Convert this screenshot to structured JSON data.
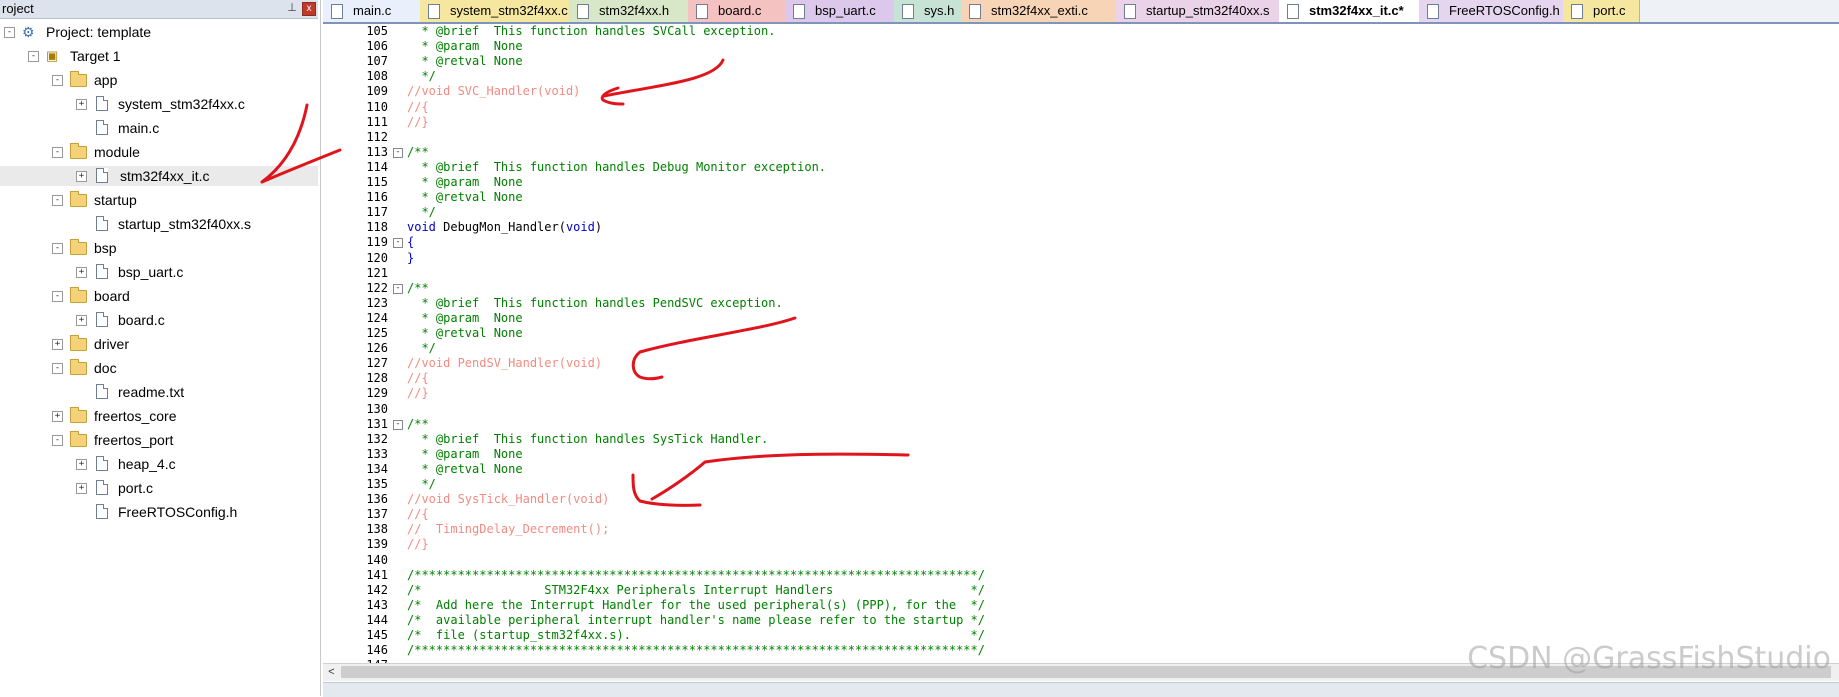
{
  "project_panel": {
    "header_title": "roject",
    "pin_glyph": "⊥",
    "close_glyph": "x",
    "tree": [
      {
        "label": "Project: template",
        "type": "project",
        "level": 0,
        "expander": "-"
      },
      {
        "label": "Target 1",
        "type": "target",
        "level": 1,
        "expander": "-"
      },
      {
        "label": "app",
        "type": "folder",
        "level": 2,
        "expander": "-"
      },
      {
        "label": "system_stm32f4xx.c",
        "type": "file",
        "level": 3,
        "expander": "+"
      },
      {
        "label": "main.c",
        "type": "file",
        "level": 3,
        "expander": ""
      },
      {
        "label": "module",
        "type": "folder",
        "level": 2,
        "expander": "-"
      },
      {
        "label": "stm32f4xx_it.c",
        "type": "file",
        "level": 3,
        "expander": "+",
        "selected": true
      },
      {
        "label": "startup",
        "type": "folder",
        "level": 2,
        "expander": "-"
      },
      {
        "label": "startup_stm32f40xx.s",
        "type": "file",
        "level": 3,
        "expander": ""
      },
      {
        "label": "bsp",
        "type": "folder",
        "level": 2,
        "expander": "-"
      },
      {
        "label": "bsp_uart.c",
        "type": "file",
        "level": 3,
        "expander": "+"
      },
      {
        "label": "board",
        "type": "folder",
        "level": 2,
        "expander": "-"
      },
      {
        "label": "board.c",
        "type": "file",
        "level": 3,
        "expander": "+"
      },
      {
        "label": "driver",
        "type": "folder",
        "level": 2,
        "expander": "+"
      },
      {
        "label": "doc",
        "type": "folder",
        "level": 2,
        "expander": "-"
      },
      {
        "label": "readme.txt",
        "type": "file",
        "level": 3,
        "expander": ""
      },
      {
        "label": "freertos_core",
        "type": "folder",
        "level": 2,
        "expander": "+"
      },
      {
        "label": "freertos_port",
        "type": "folder",
        "level": 2,
        "expander": "-"
      },
      {
        "label": "heap_4.c",
        "type": "file",
        "level": 3,
        "expander": "+"
      },
      {
        "label": "port.c",
        "type": "file",
        "level": 3,
        "expander": "+"
      },
      {
        "label": "FreeRTOSConfig.h",
        "type": "file",
        "level": 3,
        "expander": ""
      }
    ]
  },
  "tabs": [
    {
      "label": "main.c",
      "color": "#eaf0fb",
      "active": false
    },
    {
      "label": "system_stm32f4xx.c",
      "color": "#f5e6a0",
      "active": false
    },
    {
      "label": "stm32f4xx.h",
      "color": "#d7e7c8",
      "active": false
    },
    {
      "label": "board.c",
      "color": "#f5c2c2",
      "active": false
    },
    {
      "label": "bsp_uart.c",
      "color": "#dcc8ea",
      "active": false
    },
    {
      "label": "sys.h",
      "color": "#c7e3d6",
      "active": false
    },
    {
      "label": "stm32f4xx_exti.c",
      "color": "#f7d4b5",
      "active": false
    },
    {
      "label": "startup_stm32f40xx.s",
      "color": "#ead2e8",
      "active": false
    },
    {
      "label": "stm32f4xx_it.c*",
      "color": "#ffffff",
      "active": true
    },
    {
      "label": "FreeRTOSConfig.h",
      "color": "#e6d5ee",
      "active": false
    },
    {
      "label": "port.c",
      "color": "#f5e6a0",
      "active": false
    }
  ],
  "editor": {
    "lines": [
      {
        "n": "105",
        "fold": "",
        "parts": [
          {
            "t": "  * @brief  This function handles SVCall exception.",
            "c": "comment"
          }
        ]
      },
      {
        "n": "106",
        "fold": "",
        "parts": [
          {
            "t": "  * @param  None",
            "c": "comment"
          }
        ]
      },
      {
        "n": "107",
        "fold": "",
        "parts": [
          {
            "t": "  * @retval None",
            "c": "comment"
          }
        ]
      },
      {
        "n": "108",
        "fold": "",
        "parts": [
          {
            "t": "  */",
            "c": "comment"
          }
        ]
      },
      {
        "n": "109",
        "fold": "",
        "parts": [
          {
            "t": "//void SVC_Handler(void)",
            "c": "disabled"
          }
        ]
      },
      {
        "n": "110",
        "fold": "",
        "parts": [
          {
            "t": "//{",
            "c": "disabled"
          }
        ]
      },
      {
        "n": "111",
        "fold": "",
        "parts": [
          {
            "t": "//}",
            "c": "disabled"
          }
        ]
      },
      {
        "n": "112",
        "fold": "",
        "parts": []
      },
      {
        "n": "113",
        "fold": "-",
        "parts": [
          {
            "t": "/**",
            "c": "comment"
          }
        ]
      },
      {
        "n": "114",
        "fold": "",
        "parts": [
          {
            "t": "  * @brief  This function handles Debug Monitor exception.",
            "c": "comment"
          }
        ]
      },
      {
        "n": "115",
        "fold": "",
        "parts": [
          {
            "t": "  * @param  None",
            "c": "comment"
          }
        ]
      },
      {
        "n": "116",
        "fold": "",
        "parts": [
          {
            "t": "  * @retval None",
            "c": "comment"
          }
        ]
      },
      {
        "n": "117",
        "fold": "",
        "parts": [
          {
            "t": "  */",
            "c": "comment"
          }
        ]
      },
      {
        "n": "118",
        "fold": "",
        "parts": [
          {
            "t": "void",
            "c": "kw"
          },
          {
            "t": " DebugMon_Handler(",
            "c": "plain"
          },
          {
            "t": "void",
            "c": "kw"
          },
          {
            "t": ")",
            "c": "plain"
          }
        ]
      },
      {
        "n": "119",
        "fold": "-",
        "parts": [
          {
            "t": "{",
            "c": "kw"
          }
        ]
      },
      {
        "n": "120",
        "fold": "",
        "parts": [
          {
            "t": "}",
            "c": "kw"
          }
        ]
      },
      {
        "n": "121",
        "fold": "",
        "parts": []
      },
      {
        "n": "122",
        "fold": "-",
        "parts": [
          {
            "t": "/**",
            "c": "comment"
          }
        ]
      },
      {
        "n": "123",
        "fold": "",
        "parts": [
          {
            "t": "  * @brief  This function handles PendSVC exception.",
            "c": "comment"
          }
        ]
      },
      {
        "n": "124",
        "fold": "",
        "parts": [
          {
            "t": "  * @param  None",
            "c": "comment"
          }
        ]
      },
      {
        "n": "125",
        "fold": "",
        "parts": [
          {
            "t": "  * @retval None",
            "c": "comment"
          }
        ]
      },
      {
        "n": "126",
        "fold": "",
        "parts": [
          {
            "t": "  */",
            "c": "comment"
          }
        ]
      },
      {
        "n": "127",
        "fold": "",
        "parts": [
          {
            "t": "//void PendSV_Handler(void)",
            "c": "disabled"
          }
        ]
      },
      {
        "n": "128",
        "fold": "",
        "parts": [
          {
            "t": "//{",
            "c": "disabled"
          }
        ]
      },
      {
        "n": "129",
        "fold": "",
        "parts": [
          {
            "t": "//}",
            "c": "disabled"
          }
        ]
      },
      {
        "n": "130",
        "fold": "",
        "parts": []
      },
      {
        "n": "131",
        "fold": "-",
        "parts": [
          {
            "t": "/**",
            "c": "comment"
          }
        ]
      },
      {
        "n": "132",
        "fold": "",
        "parts": [
          {
            "t": "  * @brief  This function handles SysTick Handler.",
            "c": "comment"
          }
        ]
      },
      {
        "n": "133",
        "fold": "",
        "parts": [
          {
            "t": "  * @param  None",
            "c": "comment"
          }
        ]
      },
      {
        "n": "134",
        "fold": "",
        "parts": [
          {
            "t": "  * @retval None",
            "c": "comment"
          }
        ]
      },
      {
        "n": "135",
        "fold": "",
        "parts": [
          {
            "t": "  */",
            "c": "comment"
          }
        ]
      },
      {
        "n": "136",
        "fold": "",
        "parts": [
          {
            "t": "//void SysTick_Handler(void)",
            "c": "disabled"
          }
        ]
      },
      {
        "n": "137",
        "fold": "",
        "parts": [
          {
            "t": "//{",
            "c": "disabled"
          }
        ]
      },
      {
        "n": "138",
        "fold": "",
        "parts": [
          {
            "t": "//  TimingDelay_Decrement();",
            "c": "disabled"
          }
        ]
      },
      {
        "n": "139",
        "fold": "",
        "parts": [
          {
            "t": "//}",
            "c": "disabled"
          }
        ]
      },
      {
        "n": "140",
        "fold": "",
        "parts": []
      },
      {
        "n": "141",
        "fold": "",
        "parts": [
          {
            "t": "/******************************************************************************/",
            "c": "comment"
          }
        ]
      },
      {
        "n": "142",
        "fold": "",
        "parts": [
          {
            "t": "/*                 STM32F4xx Peripherals Interrupt Handlers                   */",
            "c": "comment"
          }
        ]
      },
      {
        "n": "143",
        "fold": "",
        "parts": [
          {
            "t": "/*  Add here the Interrupt Handler for the used peripheral(s) (PPP), for the  */",
            "c": "comment"
          }
        ]
      },
      {
        "n": "144",
        "fold": "",
        "parts": [
          {
            "t": "/*  available peripheral interrupt handler's name please refer to the startup */",
            "c": "comment"
          }
        ]
      },
      {
        "n": "145",
        "fold": "",
        "parts": [
          {
            "t": "/*  file (startup_stm32f4xx.s).                                               */",
            "c": "comment"
          }
        ]
      },
      {
        "n": "146",
        "fold": "",
        "parts": [
          {
            "t": "/******************************************************************************/",
            "c": "comment"
          }
        ]
      },
      {
        "n": "147",
        "fold": "",
        "parts": []
      }
    ]
  },
  "scrollbar": {
    "left_arrow": "<"
  },
  "watermark": "CSDN @GrassFishStudio",
  "colors": {
    "comment": "#008000",
    "disabled": "#f28b82",
    "keyword": "#0000cc",
    "annotation": "#e0141c"
  }
}
